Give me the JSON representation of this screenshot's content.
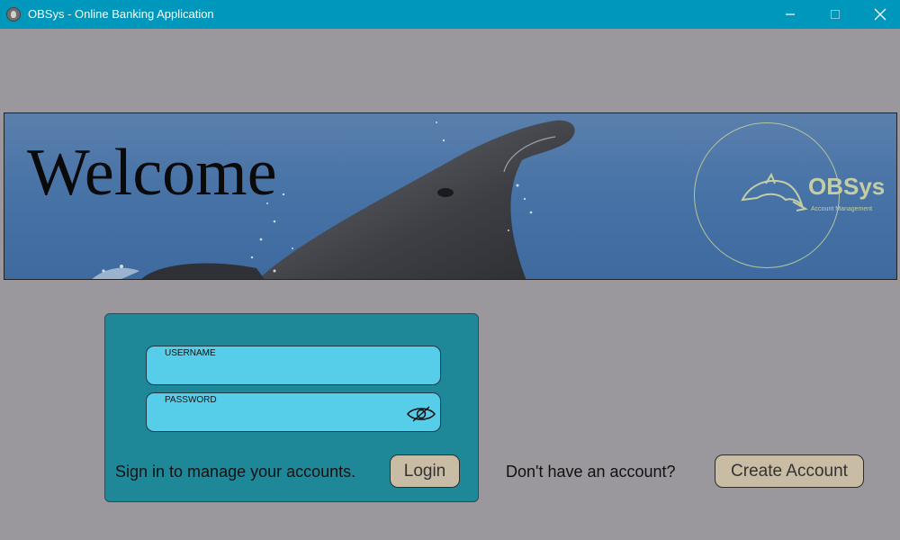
{
  "window": {
    "title": "OBSys - Online Banking Application",
    "controls": [
      "minimize",
      "maximize",
      "close"
    ],
    "background_color": "#9b989d",
    "titlebar_color": "#0097bd"
  },
  "banner": {
    "welcome_text": "Welcome",
    "brand_name": "OBSys",
    "brand_tagline": "Account Management",
    "image_subject": "dolphin leaping from blue water",
    "brand_logo_icon": "dolphin-logo-icon"
  },
  "login": {
    "username_label": "USERNAME",
    "username_value": "",
    "password_label": "PASSWORD",
    "password_value": "",
    "visibility_icon": "eye-slash-icon",
    "prompt": "Sign in to manage your accounts.",
    "login_button": "Login",
    "card_color": "#1f8898",
    "field_color": "#56cde9"
  },
  "signup": {
    "prompt": "Don't have an account?",
    "create_button": "Create Account",
    "button_color": "#c9bca5"
  }
}
